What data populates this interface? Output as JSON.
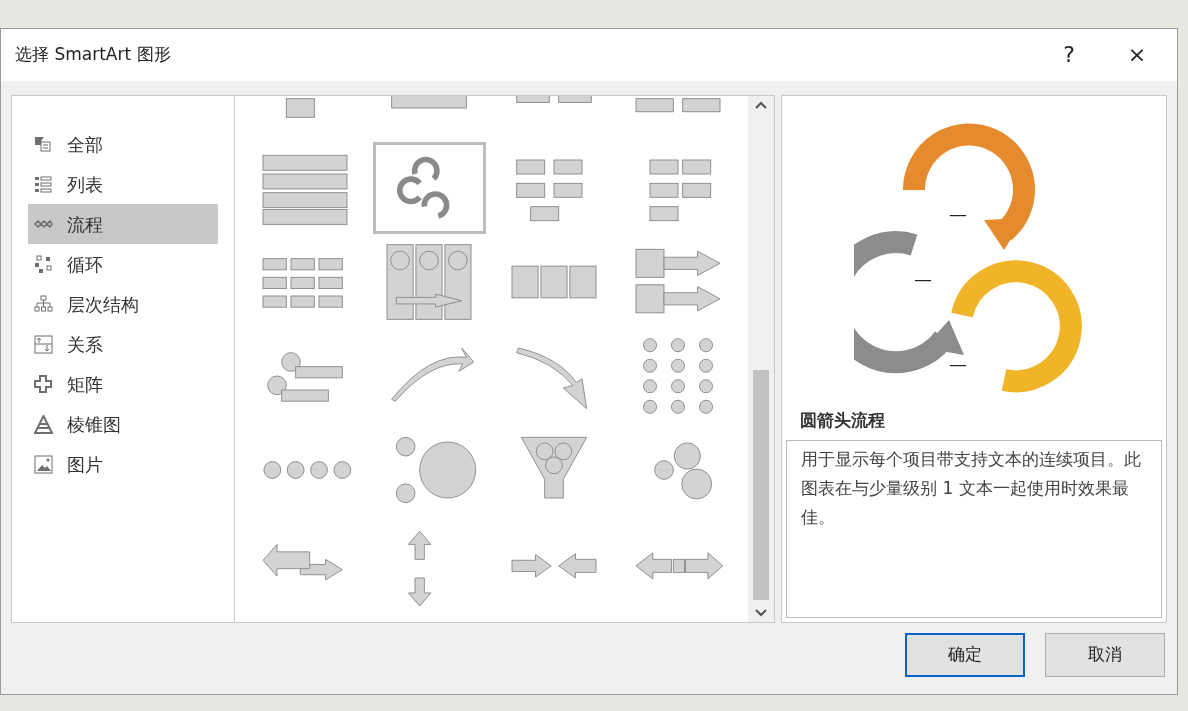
{
  "window": {
    "title": "选择 SmartArt 图形",
    "help": "?",
    "close": "×"
  },
  "categories": [
    {
      "label": "全部",
      "selected": false
    },
    {
      "label": "列表",
      "selected": false
    },
    {
      "label": "流程",
      "selected": true
    },
    {
      "label": "循环",
      "selected": false
    },
    {
      "label": "层次结构",
      "selected": false
    },
    {
      "label": "关系",
      "selected": false
    },
    {
      "label": "矩阵",
      "selected": false
    },
    {
      "label": "棱锥图",
      "selected": false
    },
    {
      "label": "图片",
      "selected": false
    }
  ],
  "gallery": {
    "items": [
      {
        "selected": false
      },
      {
        "selected": false
      },
      {
        "selected": false
      },
      {
        "selected": false
      },
      {
        "selected": false
      },
      {
        "selected": true
      },
      {
        "selected": false
      },
      {
        "selected": false
      },
      {
        "selected": false
      },
      {
        "selected": false
      },
      {
        "selected": false
      },
      {
        "selected": false
      },
      {
        "selected": false
      },
      {
        "selected": false
      },
      {
        "selected": false
      },
      {
        "selected": false
      },
      {
        "selected": false
      },
      {
        "selected": false
      },
      {
        "selected": false
      },
      {
        "selected": false
      },
      {
        "selected": false
      },
      {
        "selected": false
      },
      {
        "selected": false
      },
      {
        "selected": false
      }
    ]
  },
  "preview": {
    "labels": [
      "—",
      "—",
      "—"
    ],
    "title": "圆箭头流程",
    "description": "用于显示每个项目带支持文本的连续项目。此图表在与少量级别 1 文本一起使用时效果最佳。"
  },
  "buttons": [
    {
      "label": "确定",
      "default": true
    },
    {
      "label": "取消",
      "default": false
    }
  ]
}
